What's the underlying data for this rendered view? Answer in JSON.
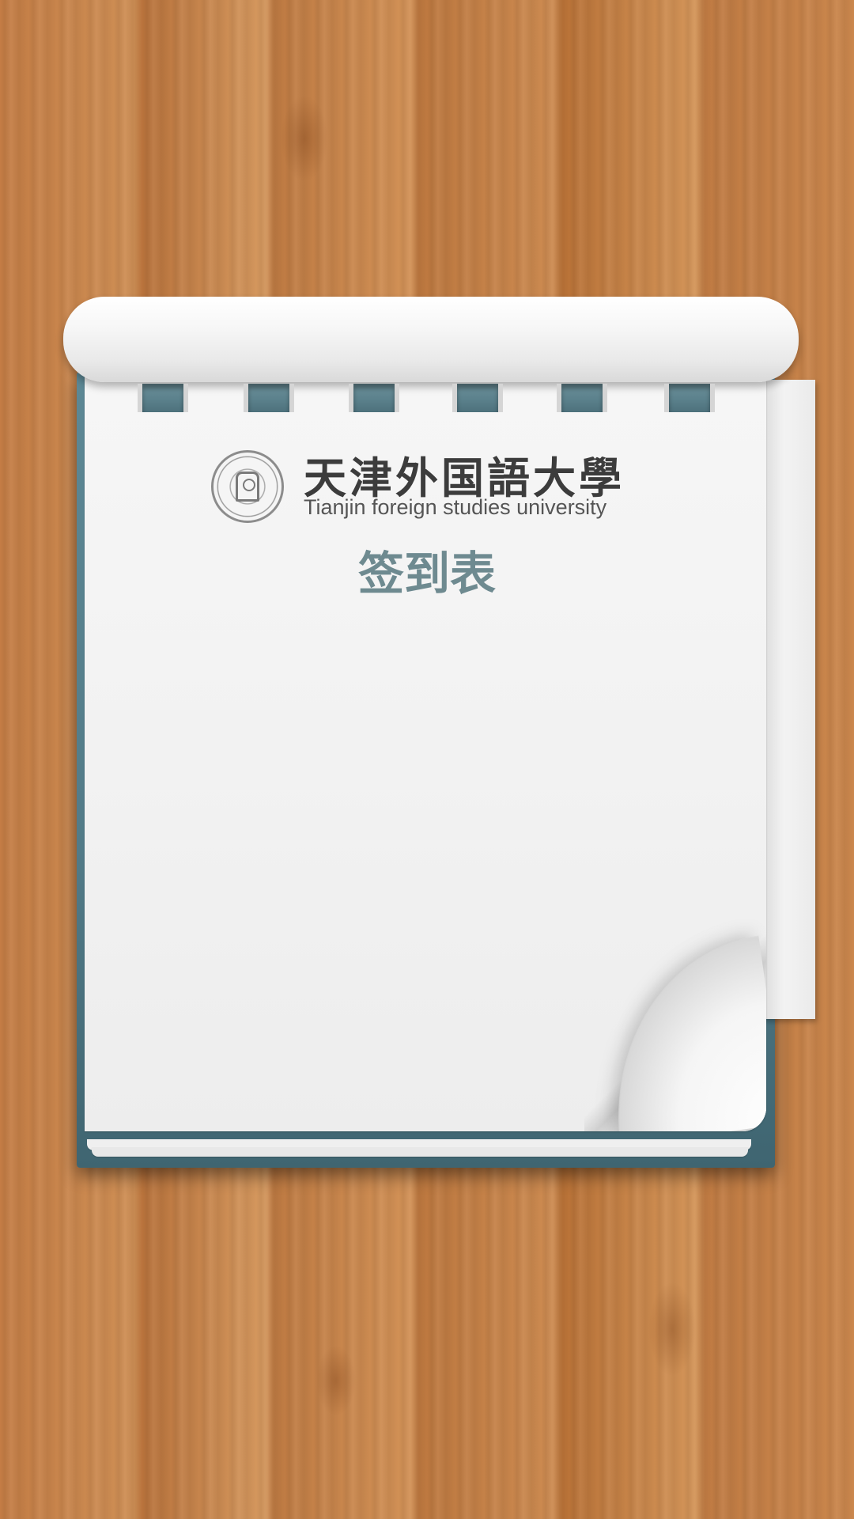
{
  "header": {
    "university_name_cn": "天津外国語大學",
    "university_name_en": "Tianjin foreign studies university",
    "seal_icon": "university-seal-icon"
  },
  "page": {
    "title": "签到表"
  },
  "colors": {
    "wood": "#c8864e",
    "cover": "#5d8895",
    "paper": "#f2f2f2",
    "title": "#6e8a90"
  }
}
